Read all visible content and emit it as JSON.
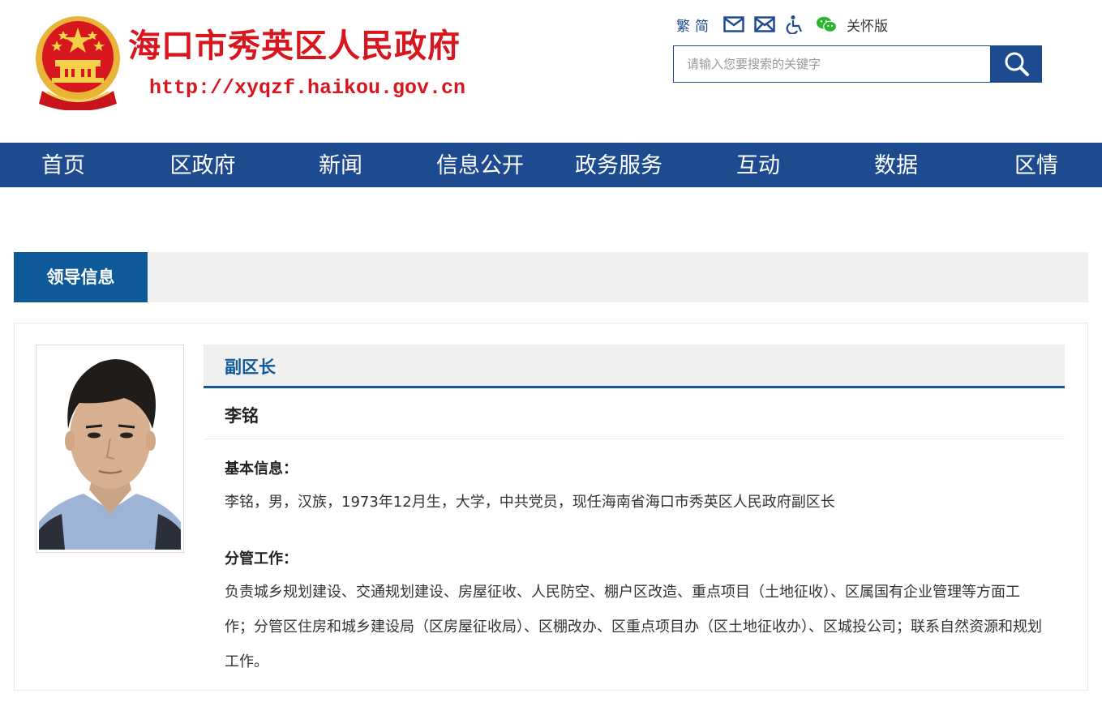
{
  "header": {
    "site_title": "海口市秀英区人民政府",
    "site_url": "http://xyqzf.haikou.gov.cn",
    "toolbar": {
      "traditional": "繁",
      "simplified": "简",
      "care_version": "关怀版"
    },
    "search": {
      "placeholder": "请输入您要搜索的关键字"
    }
  },
  "nav": {
    "items": [
      "首页",
      "区政府",
      "新闻",
      "信息公开",
      "政务服务",
      "互动",
      "数据",
      "区情"
    ]
  },
  "section": {
    "tab_label": "领导信息"
  },
  "leader": {
    "role": "副区长",
    "name": "李铭",
    "basic_label": "基本信息：",
    "basic_text": "李铭，男，汉族，1973年12月生，大学，中共党员，现任海南省海口市秀英区人民政府副区长",
    "duty_label": "分管工作：",
    "duty_text": "负责城乡规划建设、交通规划建设、房屋征收、人民防空、棚户区改造、重点项目（土地征收）、区属国有企业管理等方面工作；分管区住房和城乡建设局（区房屋征收局）、区棚改办、区重点项目办（区土地征收办）、区城投公司；联系自然资源和规划工作。"
  },
  "colors": {
    "brand_blue": "#1e4b8f",
    "section_blue": "#0e5a99",
    "title_red": "#d7161d"
  },
  "icons": [
    "national-emblem-icon",
    "mail-icon",
    "mail-cross-icon",
    "accessibility-icon",
    "wechat-icon",
    "search-icon"
  ]
}
